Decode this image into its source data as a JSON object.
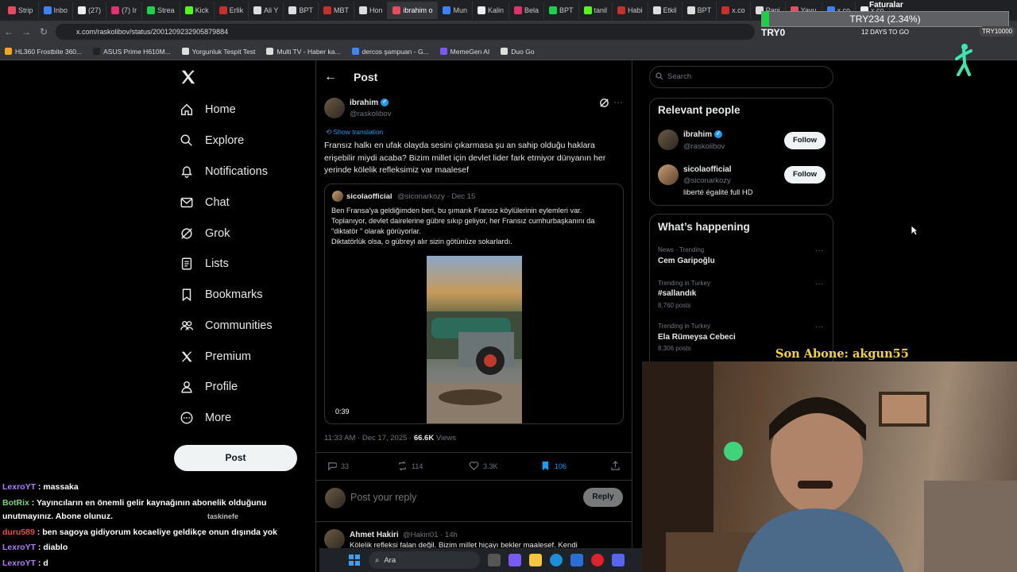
{
  "browser": {
    "tabs": [
      "Strip",
      "Inbo",
      "(27)",
      "(7) Ir",
      "Strea",
      "Kick",
      "Erlik",
      "Ali Y",
      "BPT",
      "MBT",
      "Hon",
      "ibrahim o",
      "Mun",
      "Kalin",
      "Bela",
      "BPT",
      "tanil",
      "Habi",
      "Etkil",
      "BPT",
      "x.co",
      "Papi",
      "Yavu",
      "x.co",
      "x.co"
    ],
    "active_tab_index": 11,
    "url": "x.com/raskolibov/status/2001209232905879884",
    "bookmarks": [
      "HL360 Frostbite 360...",
      "ASUS Prime H610M...",
      "Yorgunluk Tespit Test",
      "Multi TV - Haber ka...",
      "dercos şampuan - G...",
      "MemeGen AI",
      "Duo Go"
    ]
  },
  "stream": {
    "ticker_title": "Faturalar",
    "ticker_text": "TRY234 (2.34%)",
    "ticker_progress": 0.0234,
    "goal_left": "TRY0",
    "days_to_go": "12 DAYS TO GO",
    "goal_right": "TRY10000",
    "son_abone": "Son Abone: akgun55"
  },
  "nav": {
    "items": [
      {
        "label": "Home",
        "icon": "home-icon"
      },
      {
        "label": "Explore",
        "icon": "search-icon"
      },
      {
        "label": "Notifications",
        "icon": "bell-icon"
      },
      {
        "label": "Chat",
        "icon": "mail-icon"
      },
      {
        "label": "Grok",
        "icon": "grok-icon"
      },
      {
        "label": "Lists",
        "icon": "list-icon"
      },
      {
        "label": "Bookmarks",
        "icon": "bookmark-icon"
      },
      {
        "label": "Communities",
        "icon": "communities-icon"
      },
      {
        "label": "Premium",
        "icon": "x-icon"
      },
      {
        "label": "Profile",
        "icon": "person-icon"
      },
      {
        "label": "More",
        "icon": "more-circle-icon"
      }
    ],
    "post_button": "Post"
  },
  "post": {
    "header": "Post",
    "author_name": "ibrahim",
    "author_handle": "@raskolibov",
    "show_translation": "Show translation",
    "text": "Fransız halkı en ufak olayda sesini çıkarmasa şu an sahip olduğu haklara erişebilir miydi acaba? Bizim millet için devlet lider fark etmiyor dünyanın her yerinde kölelik refleksimiz var maalesef",
    "quote": {
      "name": "sicolaofficial",
      "handle_date": "@siconarkozy · Dec 15",
      "text": "Ben Fransa'ya geldiğimden beri, bu şımarık Fransız köylülerinin eylemleri var. Toplanıyor, devlet dairelerine gübre sıkıp geliyor,  her Fransız cumhurbaşkanını da \"diktatör \" olarak görüyorlar.\nDiktatörlük olsa, o gübreyi alır sizin götünüze sokarlardı.",
      "duration": "0:39"
    },
    "meta_time": "11:33 AM · Dec 17, 2025 · ",
    "meta_views_count": "66.6K",
    "meta_views_label": " Views",
    "actions": {
      "replies": "33",
      "reposts": "114",
      "likes": "3.3K",
      "bookmarks": "106"
    },
    "reply_placeholder": "Post your reply",
    "reply_button": "Reply"
  },
  "next_reply": {
    "name": "Ahmet Hakiri",
    "handle_time": "@Hakiri01 · 14h",
    "text": "Kölelik refleksi falan değil. Bizim millet hiçayı bekler maalesef. Kendi"
  },
  "right": {
    "search_placeholder": "Search",
    "relevant_title": "Relevant people",
    "people": [
      {
        "name": "ibrahim",
        "handle": "@raskolibov",
        "bio": "",
        "follow": "Follow"
      },
      {
        "name": "sicolaofficial",
        "handle": "@siconarkozy",
        "bio": "liberté égalité full HD",
        "follow": "Follow"
      }
    ],
    "happening_title": "What’s happening",
    "trends": [
      {
        "meta": "News · Trending",
        "name": "Cem Garipoğlu",
        "posts": ""
      },
      {
        "meta": "Trending in Turkey",
        "name": "#sallandık",
        "posts": "8,760 posts"
      },
      {
        "meta": "Trending in Turkey",
        "name": "Ela Rümeysa Cebeci",
        "posts": "8,306 posts"
      }
    ]
  },
  "chat": [
    {
      "user": "LexroYT",
      "msg": " : massaka"
    },
    {
      "user": "BotRix",
      "msg": " : Yayıncıların en önemli gelir kaynağının abonelik olduğunu"
    },
    {
      "user": "",
      "msg": "unutmayınız. Abone olunuz."
    },
    {
      "user": "duru589",
      "msg": " : ben sagoya gidiyorum kocaeliye geldikçe onun dışında yok"
    },
    {
      "user": "LexroYT",
      "msg": " : diablo"
    },
    {
      "user": "LexroYT",
      "msg": " : d"
    }
  ],
  "chat_overlay_user": "taskinefe",
  "taskbar": {
    "search": "Ara"
  },
  "colors": {
    "accent": "#1d9bf0",
    "background": "#000000",
    "subscriber_text": "#f2d43a",
    "ticker_fill": "#1dd04a"
  }
}
